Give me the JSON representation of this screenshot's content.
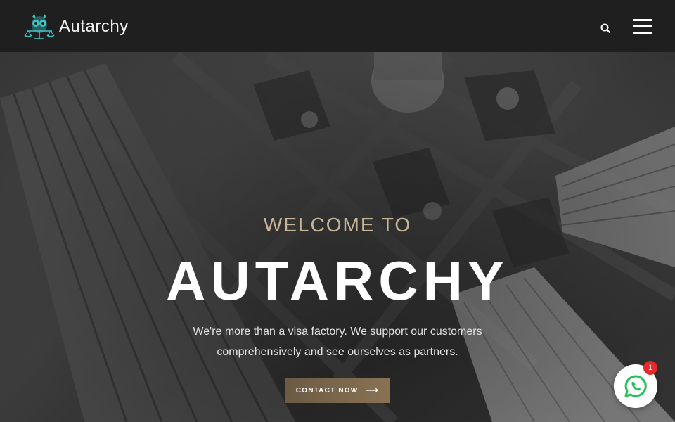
{
  "header": {
    "brand_name": "Autarchy",
    "search_icon": "search-icon",
    "menu_icon": "hamburger-menu-icon"
  },
  "hero": {
    "eyebrow": "WELCOME TO",
    "title": "AUTARCHY",
    "subtitle": "We're more than a visa factory. We support our customers comprehensively and see ourselves as partners.",
    "cta_label": "CONTACT NOW",
    "cta_arrow": "⟶"
  },
  "whatsapp": {
    "icon": "whatsapp-icon",
    "badge_count": "1"
  },
  "colors": {
    "header_bg": "#1f1f1f",
    "accent_gold": "#c8b597",
    "cta_bg": "#7a6650",
    "logo_teal": "#3fc7c7",
    "badge_red": "#e32b2b"
  }
}
